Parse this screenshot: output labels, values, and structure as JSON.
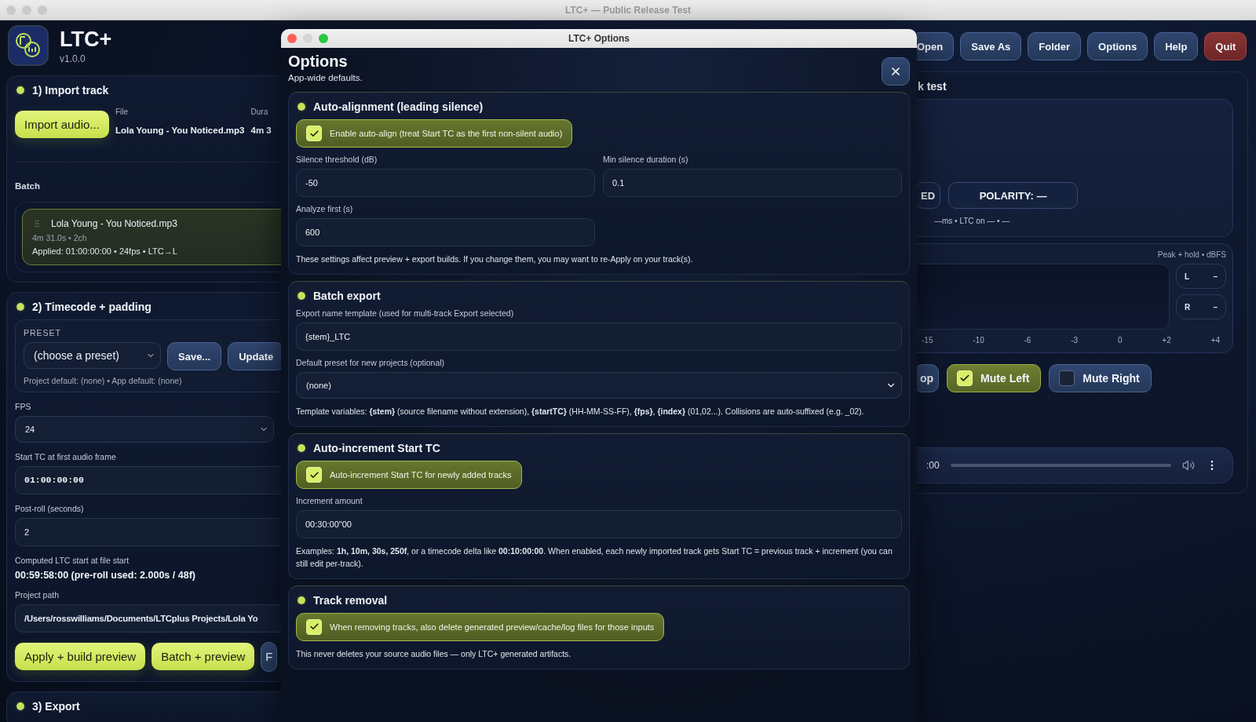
{
  "window": {
    "title": "LTC+ — Public Release Test"
  },
  "app": {
    "name": "LTC+",
    "version": "v1.0.0"
  },
  "toolbar": [
    {
      "label": "Open",
      "kind": "normal"
    },
    {
      "label": "Save As",
      "kind": "normal"
    },
    {
      "label": "Folder",
      "kind": "normal"
    },
    {
      "label": "Options",
      "kind": "normal"
    },
    {
      "label": "Help",
      "kind": "normal"
    },
    {
      "label": "Quit",
      "kind": "danger"
    }
  ],
  "import_panel": {
    "title": "1) Import track",
    "import_button": "Import audio...",
    "columns": [
      {
        "label": "File",
        "value": "Lola Young - You Noticed.mp3"
      },
      {
        "label": "Dura",
        "value": "4m 3"
      }
    ],
    "batch_label": "Batch",
    "batch": [
      {
        "name": "Lola Young - You Noticed.mp3",
        "meta": "4m 31.0s • 2ch",
        "applied": "Applied: 01:00:00:00 • 24fps • LTC→L",
        "selected": true
      }
    ]
  },
  "timecode_panel": {
    "title": "2) Timecode + padding",
    "preset": {
      "label": "PRESET",
      "value": "(choose a preset)",
      "buttons": [
        "Save...",
        "Update"
      ],
      "note": "Project default: (none) • App default: (none)"
    },
    "fps": {
      "label": "FPS",
      "value": "24"
    },
    "start_tc": {
      "label": "Start TC at first audio frame",
      "value": "01:00:00:00"
    },
    "post_roll": {
      "label": "Post-roll (seconds)",
      "value": "2"
    },
    "computed": {
      "label": "Computed LTC start at file start",
      "value": "00:59:58:00 (pre-roll used: 2.000s / 48f)"
    },
    "project_path": {
      "label": "Project path",
      "value": "/Users/rosswilliams/Documents/LTCplus Projects/Lola Yo"
    },
    "actions": [
      {
        "label": "Apply + build preview",
        "kind": "primary"
      },
      {
        "label": "Batch + preview",
        "kind": "primary"
      },
      {
        "label": "F",
        "kind": "secondary"
      }
    ]
  },
  "export_panel": {
    "title": "3) Export"
  },
  "check_panel": {
    "title": "k test",
    "badges": [
      "ED",
      "POLARITY: —"
    ],
    "status": "—ms • LTC on — • —",
    "meter": {
      "caption": "Peak + hold • dBFS",
      "channels": [
        {
          "name": "L",
          "reading": "–"
        },
        {
          "name": "R",
          "reading": "–"
        }
      ],
      "scale": [
        "-15",
        "-10",
        "-6",
        "-3",
        "0",
        "+2",
        "+4"
      ]
    },
    "buttons": [
      {
        "label": "op",
        "kind": "button"
      },
      {
        "label": "Mute Left",
        "kind": "toggle",
        "checked": true
      },
      {
        "label": "Mute Right",
        "kind": "toggle",
        "checked": false
      }
    ],
    "player": {
      "time": ":00"
    }
  },
  "options_dialog": {
    "title": "LTC+ Options",
    "heading": "Options",
    "subtitle": "App-wide defaults.",
    "sections": [
      {
        "title": "Auto-alignment (leading silence)",
        "items": [
          {
            "kind": "checkbox",
            "label": "Enable auto-align (treat Start TC as the first non-silent audio)",
            "checked": true
          },
          {
            "kind": "fields",
            "fields": [
              {
                "label": "Silence threshold (dB)",
                "value": "-50"
              },
              {
                "label": "Min silence duration (s)",
                "value": "0.1"
              }
            ]
          },
          {
            "kind": "fields",
            "fields": [
              {
                "label": "Analyze first (s)",
                "value": "600"
              }
            ]
          },
          {
            "kind": "note",
            "text": "These settings affect preview + export builds. If you change them, you may want to re-Apply on your track(s)."
          }
        ]
      },
      {
        "title": "Batch export",
        "items": [
          {
            "kind": "field",
            "label": "Export name template (used for multi-track Export selected)",
            "value": "{stem}_LTC"
          },
          {
            "kind": "select",
            "label": "Default preset for new projects (optional)",
            "value": "(none)"
          },
          {
            "kind": "note",
            "text": "Template variables: **{stem}** (source filename without extension), **{startTC}** (HH-MM-SS-FF), **{fps}**, **{index}** (01,02...). Collisions are auto-suffixed (e.g. _02)."
          }
        ]
      },
      {
        "title": "Auto-increment Start TC",
        "items": [
          {
            "kind": "checkbox",
            "label": "Auto-increment Start TC for newly added tracks",
            "checked": true
          },
          {
            "kind": "field",
            "label": "Increment amount",
            "value": "00:30:00\"00"
          },
          {
            "kind": "note",
            "text": "Examples: **1h, 10m, 30s, 250f**, or a timecode delta like **00:10:00:00**. When enabled, each newly imported track gets Start TC = previous track + increment (you can still edit per-track)."
          }
        ]
      },
      {
        "title": "Track removal",
        "items": [
          {
            "kind": "checkbox",
            "label": "When removing tracks, also delete generated preview/cache/log files for those inputs",
            "checked": true
          },
          {
            "kind": "note",
            "text": "This never deletes your source audio files — only LTC+ generated artifacts."
          }
        ]
      }
    ]
  }
}
